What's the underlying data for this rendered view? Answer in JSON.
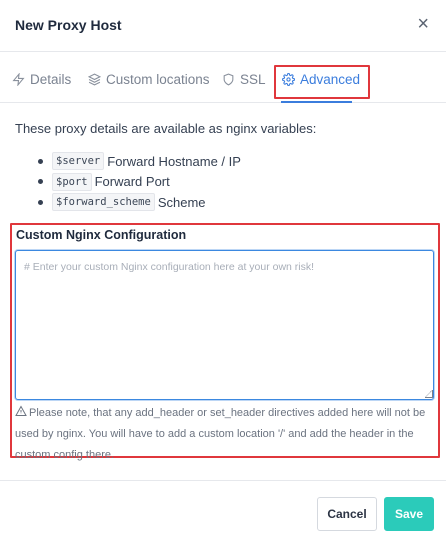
{
  "modal": {
    "title": "New Proxy Host",
    "close_label": "×"
  },
  "tabs": [
    {
      "label": "Details",
      "icon": "bolt-icon"
    },
    {
      "label": "Custom locations",
      "icon": "layers-icon"
    },
    {
      "label": "SSL",
      "icon": "shield-icon"
    },
    {
      "label": "Advanced",
      "icon": "gear-icon",
      "active": true
    }
  ],
  "advanced": {
    "intro": "These proxy details are available as nginx variables:",
    "variables": [
      {
        "code": "$server",
        "desc": "Forward Hostname / IP"
      },
      {
        "code": "$port",
        "desc": "Forward Port"
      },
      {
        "code": "$forward_scheme",
        "desc": "Scheme"
      }
    ],
    "config_label": "Custom Nginx Configuration",
    "config_placeholder": "# Enter your custom Nginx configuration here at your own risk!",
    "config_value": "",
    "note": "Please note, that any add_header or set_header directives added here will not be used by nginx. You will have to add a custom location '/' and add the header in the custom config there."
  },
  "footer": {
    "cancel_label": "Cancel",
    "save_label": "Save"
  },
  "colors": {
    "accent": "#3b7ddd",
    "save": "#2bcbba",
    "highlight": "#e0373c"
  }
}
